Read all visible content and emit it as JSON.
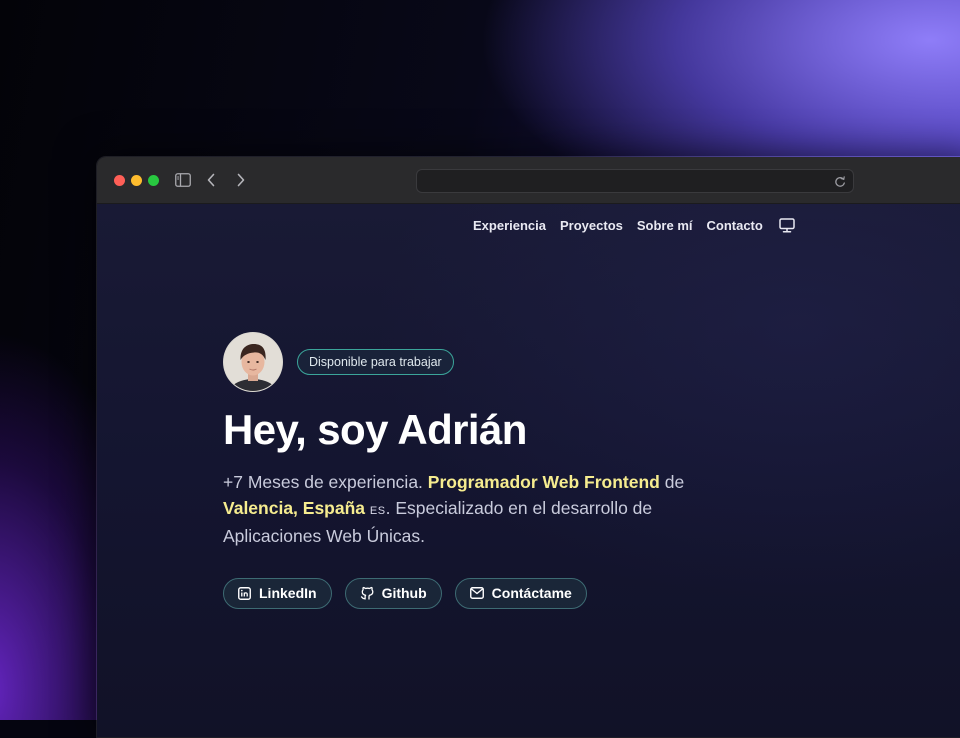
{
  "browser": {
    "window_controls": [
      "close",
      "minimize",
      "zoom"
    ],
    "toolbar_icons": [
      "sidebar-icon",
      "back-icon",
      "forward-icon"
    ],
    "address_bar": {
      "url": "",
      "reload_icon": "reload-icon"
    }
  },
  "nav": {
    "items": [
      "Experiencia",
      "Proyectos",
      "Sobre mí",
      "Contacto"
    ],
    "theme_icon": "monitor-icon"
  },
  "hero": {
    "badge": "Disponible para trabajar",
    "title": "Hey, soy Adrián",
    "desc_part1": "+7 Meses de experiencia. ",
    "desc_highlight1": "Programador Web Frontend",
    "desc_part2": " de ",
    "desc_highlight2": "Valencia, España",
    "desc_flag": "ES",
    "desc_part3": ". Especializado en el desarrollo de Aplicaciones Web Únicas."
  },
  "buttons": [
    {
      "label": "LinkedIn",
      "icon": "linkedin-icon"
    },
    {
      "label": "Github",
      "icon": "github-icon"
    },
    {
      "label": "Contáctame",
      "icon": "mail-icon"
    }
  ],
  "colors": {
    "highlight": "#f6ec8f",
    "badge_border": "#3ba59a",
    "page_bg": "#161731",
    "accent_glow": "#9482ff"
  }
}
